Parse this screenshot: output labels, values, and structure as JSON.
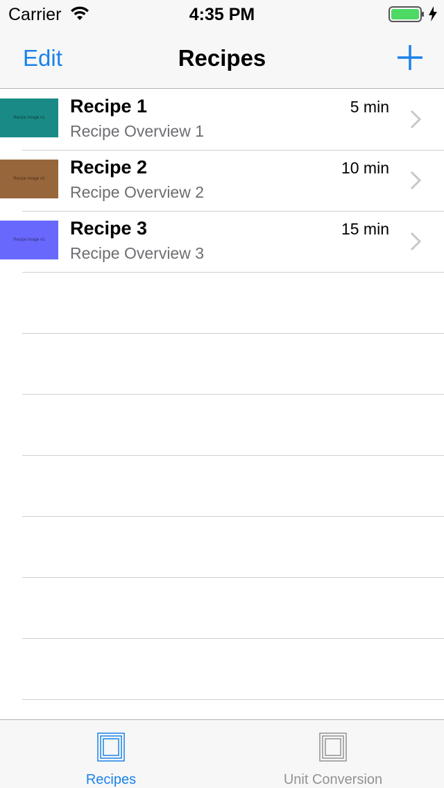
{
  "status_bar": {
    "carrier": "Carrier",
    "time": "4:35 PM",
    "battery_color": "#4cd964"
  },
  "nav": {
    "edit_label": "Edit",
    "title": "Recipes",
    "accent_color": "#1a82ea"
  },
  "recipes": [
    {
      "title": "Recipe 1",
      "overview": "Recipe Overview 1",
      "duration": "5 min",
      "image_label": "Recipe Image #1",
      "image_color": "#1a8a86"
    },
    {
      "title": "Recipe 2",
      "overview": "Recipe Overview 2",
      "duration": "10 min",
      "image_label": "Recipe Image #2",
      "image_color": "#98663b"
    },
    {
      "title": "Recipe 3",
      "overview": "Recipe Overview 3",
      "duration": "15 min",
      "image_label": "Recipe Image #2",
      "image_color": "#6868fc"
    }
  ],
  "tabs": [
    {
      "label": "Recipes",
      "icon": "recipes-tab-icon",
      "active": true
    },
    {
      "label": "Unit Conversion",
      "icon": "unit-conversion-tab-icon",
      "active": false
    }
  ]
}
